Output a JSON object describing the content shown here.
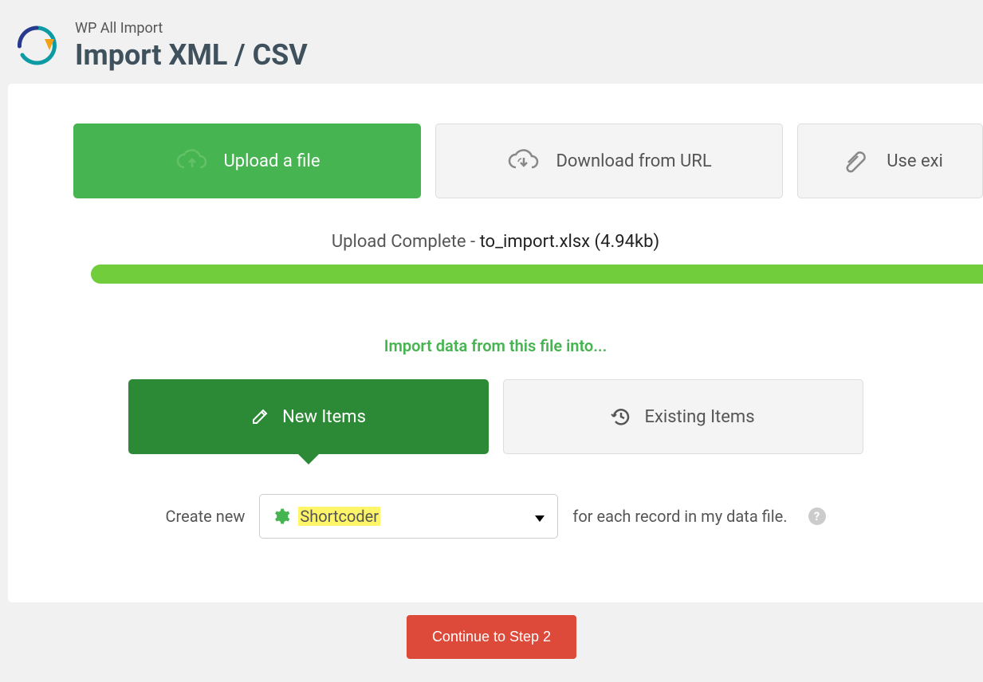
{
  "header": {
    "subtitle": "WP All Import",
    "title": "Import XML / CSV"
  },
  "source_tabs": {
    "upload": "Upload a file",
    "download": "Download from URL",
    "existing": "Use exi"
  },
  "status": {
    "prefix": "Upload Complete - ",
    "filename": "to_import.xlsx (4.94kb)"
  },
  "import_prompt": "Import data from this file into...",
  "choice": {
    "new_items": "New Items",
    "existing_items": "Existing Items"
  },
  "create": {
    "label_before": "Create new",
    "selected": "Shortcoder",
    "label_after": "for each record in my data file."
  },
  "continue_button": "Continue to Step 2"
}
